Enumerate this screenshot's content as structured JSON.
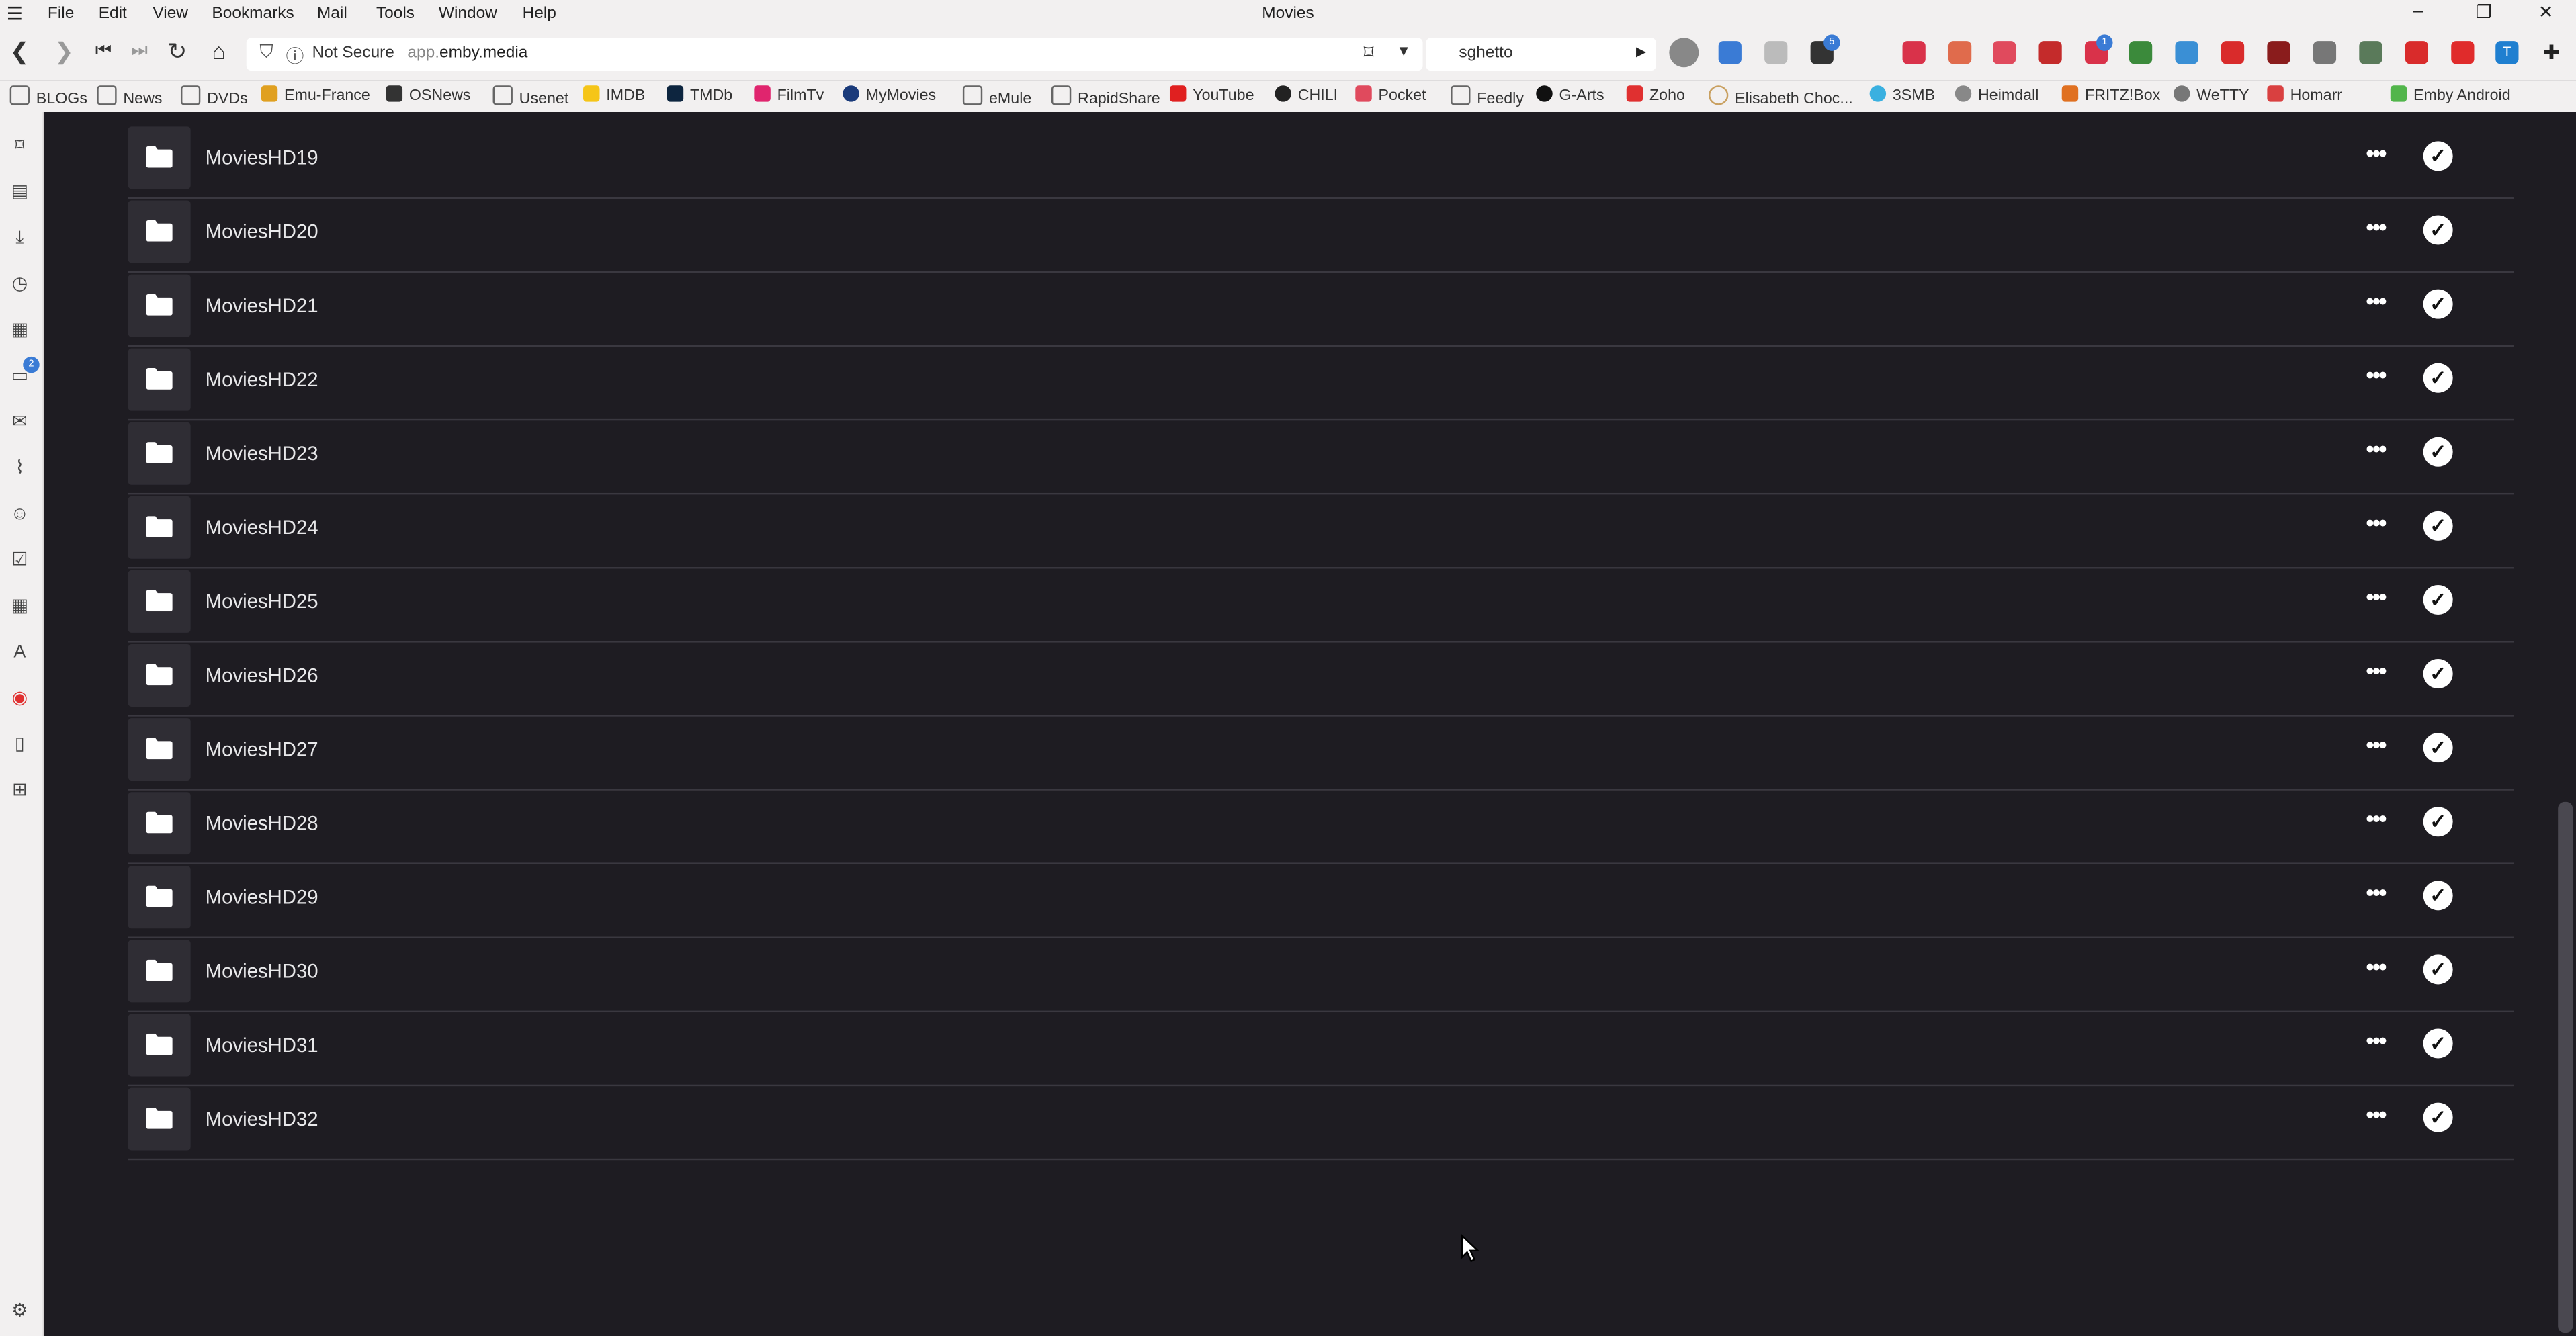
{
  "window": {
    "title": "Movies"
  },
  "menu": [
    "File",
    "Edit",
    "View",
    "Bookmarks",
    "Mail",
    "Tools",
    "Window",
    "Help"
  ],
  "address": {
    "security_label": "Not Secure",
    "url_prefix": "app.",
    "url_domain": "emby.media"
  },
  "search": {
    "value": "sghetto"
  },
  "extension_badges": {
    "tabs_count": "5",
    "adblock_count": "1"
  },
  "sidebar_badge": "2",
  "bookmarks": [
    "BLOGs",
    "News",
    "DVDs",
    "Emu-France",
    "OSNews",
    "Usenet",
    "IMDB",
    "TMDb",
    "FilmTv",
    "MyMovies",
    "eMule",
    "RapidShare",
    "YouTube",
    "CHILI",
    "Pocket",
    "Feedly",
    "G-Arts",
    "Zoho",
    "Elisabeth Choc...",
    "3SMB",
    "Heimdall",
    "FRITZ!Box",
    "WeTTY",
    "Homarr",
    "Emby Android"
  ],
  "folders": [
    {
      "name": "MoviesHD19"
    },
    {
      "name": "MoviesHD20"
    },
    {
      "name": "MoviesHD21"
    },
    {
      "name": "MoviesHD22"
    },
    {
      "name": "MoviesHD23"
    },
    {
      "name": "MoviesHD24"
    },
    {
      "name": "MoviesHD25"
    },
    {
      "name": "MoviesHD26"
    },
    {
      "name": "MoviesHD27"
    },
    {
      "name": "MoviesHD28"
    },
    {
      "name": "MoviesHD29"
    },
    {
      "name": "MoviesHD30"
    },
    {
      "name": "MoviesHD31"
    },
    {
      "name": "MoviesHD32"
    }
  ],
  "row_actions": {
    "more_icon": "more-horizontal-icon",
    "played_icon": "checkmark-circle-icon"
  },
  "colors": {
    "background": "#1e1c22",
    "chrome": "#f2f0f0",
    "divider": "#3a3840",
    "text": "#e8e8ea"
  }
}
